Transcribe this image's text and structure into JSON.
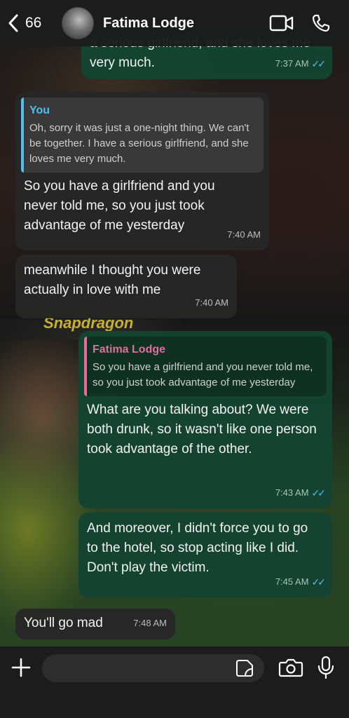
{
  "header": {
    "back_count": "66",
    "contact_name": "Fatima Lodge",
    "icons": [
      "chevron-left-icon",
      "avatar",
      "video-call-icon",
      "phone-icon"
    ]
  },
  "wallpaper": {
    "sponsor_text": "Snapdragon"
  },
  "messages": [
    {
      "direction": "outgoing",
      "text": "a serious girlfriend, and she loves me very much.",
      "time": "7:37 AM",
      "status": "read"
    },
    {
      "direction": "incoming",
      "quote_author": "You",
      "quote_text": "Oh, sorry it was just a one-night thing. We can't be together. I have a serious girlfriend, and she loves me very much.",
      "text": "So you have a girlfriend and you never told me, so you just took advantage of me yesterday",
      "time": "7:40 AM"
    },
    {
      "direction": "incoming",
      "text": "meanwhile I thought you were actually in love with me",
      "time": "7:40 AM"
    },
    {
      "direction": "outgoing",
      "quote_author": "Fatima Lodge",
      "quote_text": "So you have a girlfriend and you never told me, so you just took advantage of me yesterday",
      "text": "What are you talking about? We were both drunk, so it wasn't like one person took advantage of the other.",
      "time": "7:43 AM",
      "status": "read"
    },
    {
      "direction": "outgoing",
      "text": "And moreover, I didn't force you to go to the hotel, so stop acting like I did. Don't play the victim.",
      "time": "7:45 AM",
      "status": "read"
    },
    {
      "direction": "incoming",
      "text": "You'll go mad",
      "time": "7:48 AM"
    }
  ],
  "composer": {
    "value": "",
    "icons": [
      "plus-icon",
      "sticker-icon",
      "camera-icon",
      "microphone-icon"
    ]
  },
  "colors": {
    "incoming_bubble": "#262626",
    "outgoing_bubble": "#144432",
    "read_ticks": "#53bdeb",
    "quote_you": "#53bdeb",
    "quote_contact": "#e26d9b"
  }
}
